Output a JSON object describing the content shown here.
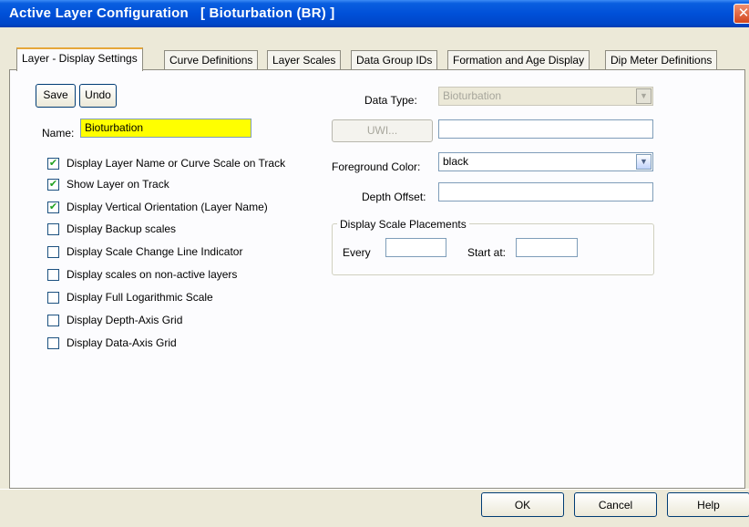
{
  "window": {
    "title": "Active Layer Configuration   [ Bioturbation (BR) ]",
    "close_glyph": "✕",
    "close_icon": "close-icon"
  },
  "tabs": [
    {
      "label": "Layer - Display Settings",
      "active": true
    },
    {
      "label": "Curve Definitions",
      "active": false
    },
    {
      "label": "Layer Scales",
      "active": false
    },
    {
      "label": "Data Group IDs",
      "active": false
    },
    {
      "label": "Formation and Age Display",
      "active": false
    },
    {
      "label": "Dip Meter Definitions",
      "active": false
    }
  ],
  "toolbar": {
    "save_label": "Save",
    "undo_label": "Undo"
  },
  "name_field": {
    "label": "Name:",
    "value": "Bioturbation",
    "highlight_color": "#ffff00"
  },
  "checkboxes": [
    {
      "label": "Display Layer Name or Curve Scale on Track",
      "checked": true
    },
    {
      "label": "Show Layer on Track",
      "checked": true
    },
    {
      "label": "Display Vertical Orientation (Layer Name)",
      "checked": true
    },
    {
      "label": "Display Backup scales",
      "checked": false
    },
    {
      "label": "Display Scale Change Line Indicator",
      "checked": false
    },
    {
      "label": "Display scales on non-active layers",
      "checked": false
    },
    {
      "label": "Display Full Logarithmic Scale",
      "checked": false
    },
    {
      "label": "Display Depth-Axis Grid",
      "checked": false
    },
    {
      "label": "Display Data-Axis Grid",
      "checked": false
    }
  ],
  "check_glyph": "✔",
  "data_type": {
    "label": "Data Type:",
    "value": "Bioturbation",
    "disabled": true
  },
  "uwi": {
    "button_label": "UWI...",
    "value": "",
    "disabled": true
  },
  "foreground_color": {
    "label": "Foreground Color:",
    "value": "black"
  },
  "depth_offset": {
    "label": "Depth Offset:",
    "value": ""
  },
  "display_scale_placements": {
    "title": "Display Scale Placements",
    "every_label": "Every",
    "every_value": "",
    "start_at_label": "Start at:",
    "start_at_value": ""
  },
  "dropdown_glyph": "▼",
  "dialog_buttons": {
    "ok_label": "OK",
    "cancel_label": "Cancel",
    "help_label": "Help"
  },
  "colors": {
    "titlebar": "#0050d8",
    "dialog_bg": "#ece9d8",
    "panel_bg": "#fcfcfe"
  }
}
